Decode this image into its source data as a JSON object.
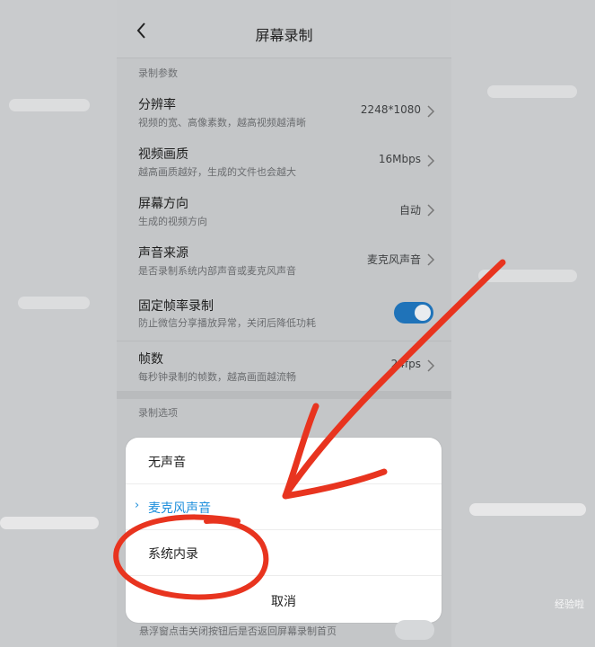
{
  "header": {
    "title": "屏幕录制"
  },
  "section1": {
    "label": "录制参数"
  },
  "rows": [
    {
      "name": "分辨率",
      "desc": "视频的宽、高像素数，越高视频越清晰",
      "value": "2248*1080"
    },
    {
      "name": "视频画质",
      "desc": "越高画质越好，生成的文件也会越大",
      "value": "16Mbps"
    },
    {
      "name": "屏幕方向",
      "desc": "生成的视频方向",
      "value": "自动"
    },
    {
      "name": "声音来源",
      "desc": "是否录制系统内部声音或麦克风声音",
      "value": "麦克风声音"
    },
    {
      "name": "固定帧率录制",
      "desc": "防止微信分享播放异常，关闭后降低功耗",
      "toggle": true
    },
    {
      "name": "帧数",
      "desc": "每秒钟录制的帧数，越高画面越流畅",
      "value": "24fps"
    }
  ],
  "section2": {
    "label": "录制选项"
  },
  "sheet": {
    "options": [
      {
        "label": "无声音",
        "selected": false
      },
      {
        "label": "麦克风声音",
        "selected": true
      },
      {
        "label": "系统内录",
        "selected": false
      }
    ],
    "cancel": "取消"
  },
  "below_text": "悬浮窗点击关闭按钮后是否返回屏幕录制首页",
  "watermark": "经验啦",
  "colors": {
    "accent": "#1e8fdc",
    "toggle_on": "#1f73b9",
    "annotation": "#e8341f"
  }
}
